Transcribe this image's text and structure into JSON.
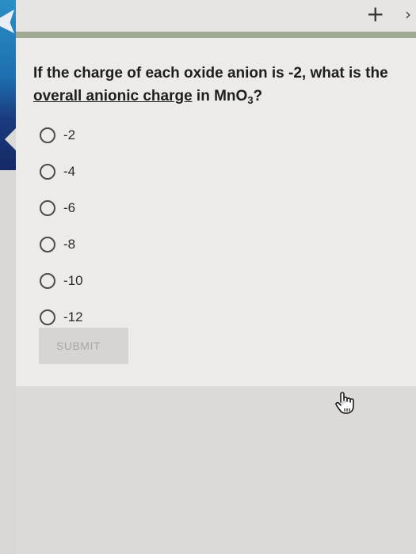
{
  "header": {
    "plus_glyph": "+",
    "edge_glyph": "›"
  },
  "question": {
    "prefix": "If the charge of each oxide anion is -2, what is the",
    "emphasis": "overall anionic charge",
    "middle": "in MnO",
    "subscript": "3",
    "suffix": "?"
  },
  "options": [
    {
      "label": "-2"
    },
    {
      "label": "-4"
    },
    {
      "label": "-6"
    },
    {
      "label": "-8"
    },
    {
      "label": "-10"
    },
    {
      "label": "-12"
    }
  ],
  "submit": {
    "label": "SUBMIT",
    "enabled": false
  },
  "icons": {
    "add": "plus-icon",
    "cursor": "hand-pointer-icon"
  },
  "colors": {
    "side_panel": "#1d6fb0",
    "rule": "#9fa994",
    "card": "#ecebe8"
  }
}
